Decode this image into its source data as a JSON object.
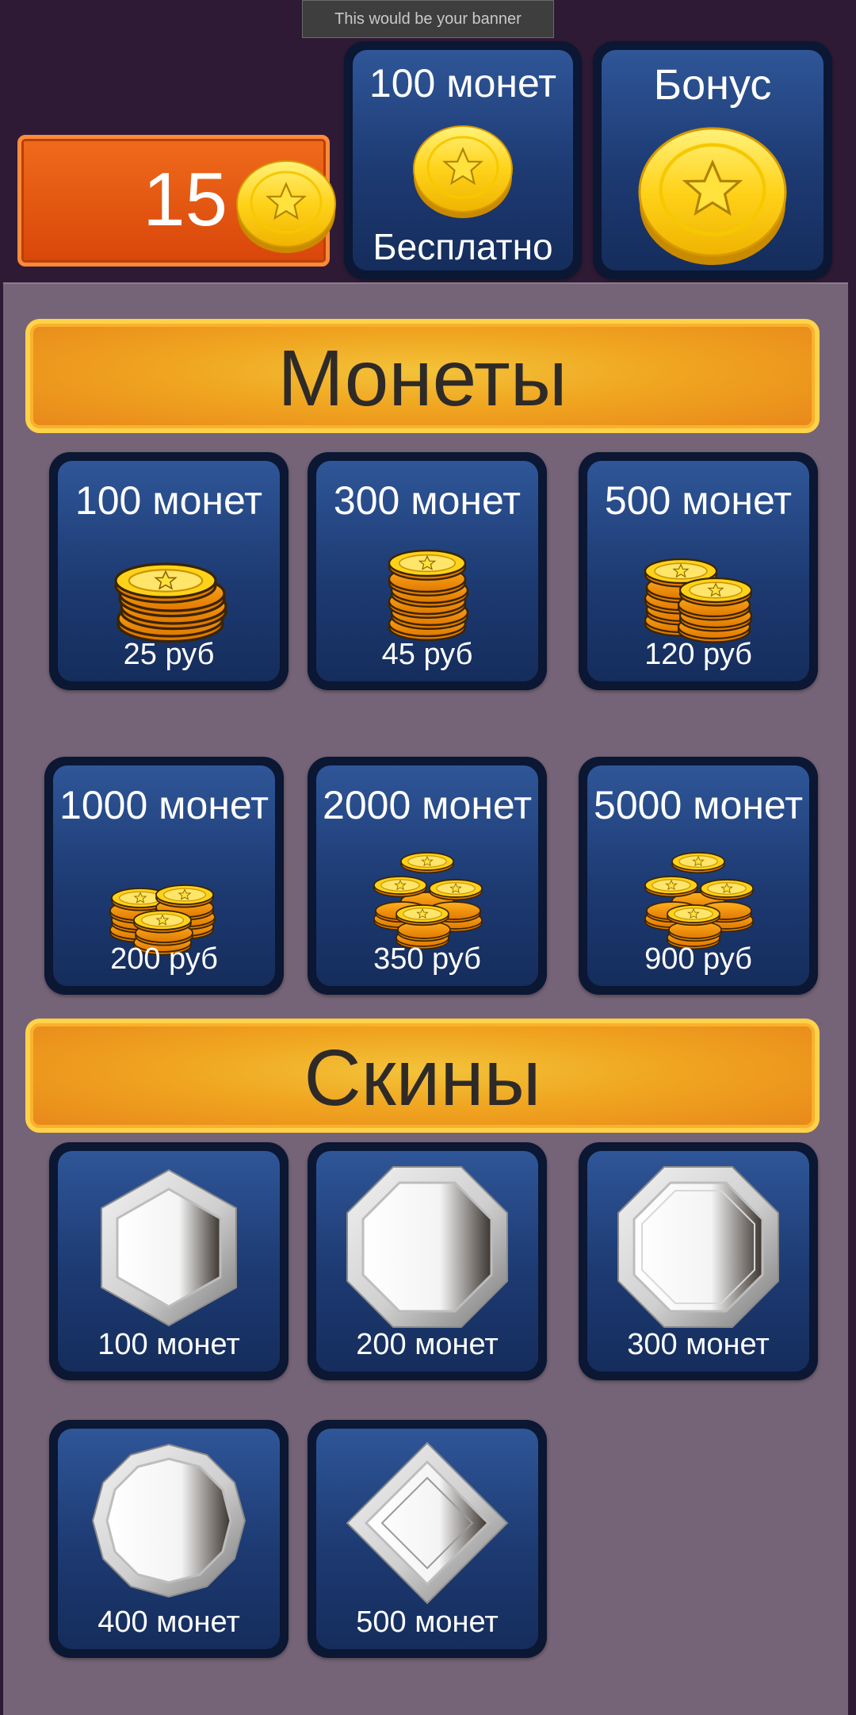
{
  "banner": {
    "text": "This would be your banner"
  },
  "balance": {
    "coins": "15"
  },
  "top_offers": [
    {
      "title": "100 монет",
      "subtitle": "Бесплатно",
      "icon": "coin-icon"
    },
    {
      "title": "Бонус",
      "icon": "large-coin-icon"
    }
  ],
  "coins_section": {
    "heading": "Монеты",
    "items": [
      {
        "amount": "100 монет",
        "price": "25 руб"
      },
      {
        "amount": "300 монет",
        "price": "45 руб"
      },
      {
        "amount": "500 монет",
        "price": "120 руб"
      },
      {
        "amount": "1000 монет",
        "price": "200 руб"
      },
      {
        "amount": "2000 монет",
        "price": "350 руб"
      },
      {
        "amount": "5000 монет",
        "price": "900 руб"
      }
    ]
  },
  "skins_section": {
    "heading": "Скины",
    "items": [
      {
        "price": "100 монет",
        "shape": "hexagon"
      },
      {
        "price": "200 монет",
        "shape": "octagon"
      },
      {
        "price": "300 монет",
        "shape": "octagon"
      },
      {
        "price": "400 монет",
        "shape": "dodecagon"
      },
      {
        "price": "500 монет",
        "shape": "diamond"
      }
    ]
  },
  "colors": {
    "background": "#2f1a36",
    "panel": "#756477",
    "card_blue": "#2f5698",
    "ribbon_orange": "#f0a520",
    "balance_orange": "#e35a12",
    "coin_gold": "#ffd21a"
  }
}
